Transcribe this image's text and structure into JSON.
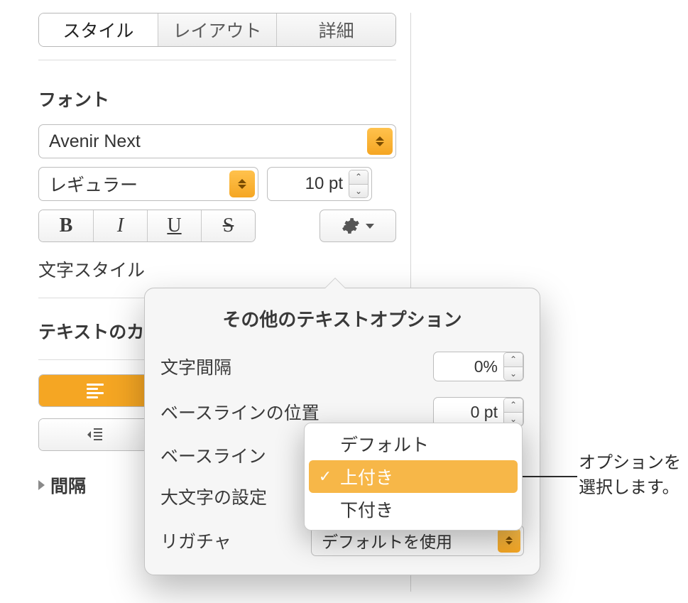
{
  "tabs": {
    "style": "スタイル",
    "layout": "レイアウト",
    "details": "詳細"
  },
  "font": {
    "section": "フォント",
    "family": "Avenir Next",
    "weight": "レギュラー",
    "size": "10 pt"
  },
  "char_style_label": "文字スタイル",
  "text_color_label": "テキストのカラー",
  "spacing_label": "間隔",
  "popover": {
    "title": "その他のテキストオプション",
    "char_spacing_label": "文字間隔",
    "char_spacing_value": "0%",
    "baseline_shift_label": "ベースラインの位置",
    "baseline_shift_value": "0 pt",
    "baseline_label": "ベースライン",
    "caps_label": "大文字の設定",
    "ligature_label": "リガチャ",
    "ligature_value": "デフォルトを使用"
  },
  "baseline_menu": {
    "default": "デフォルト",
    "superscript": "上付き",
    "subscript": "下付き"
  },
  "callout": {
    "line1": "オプションを",
    "line2": "選択します。"
  }
}
